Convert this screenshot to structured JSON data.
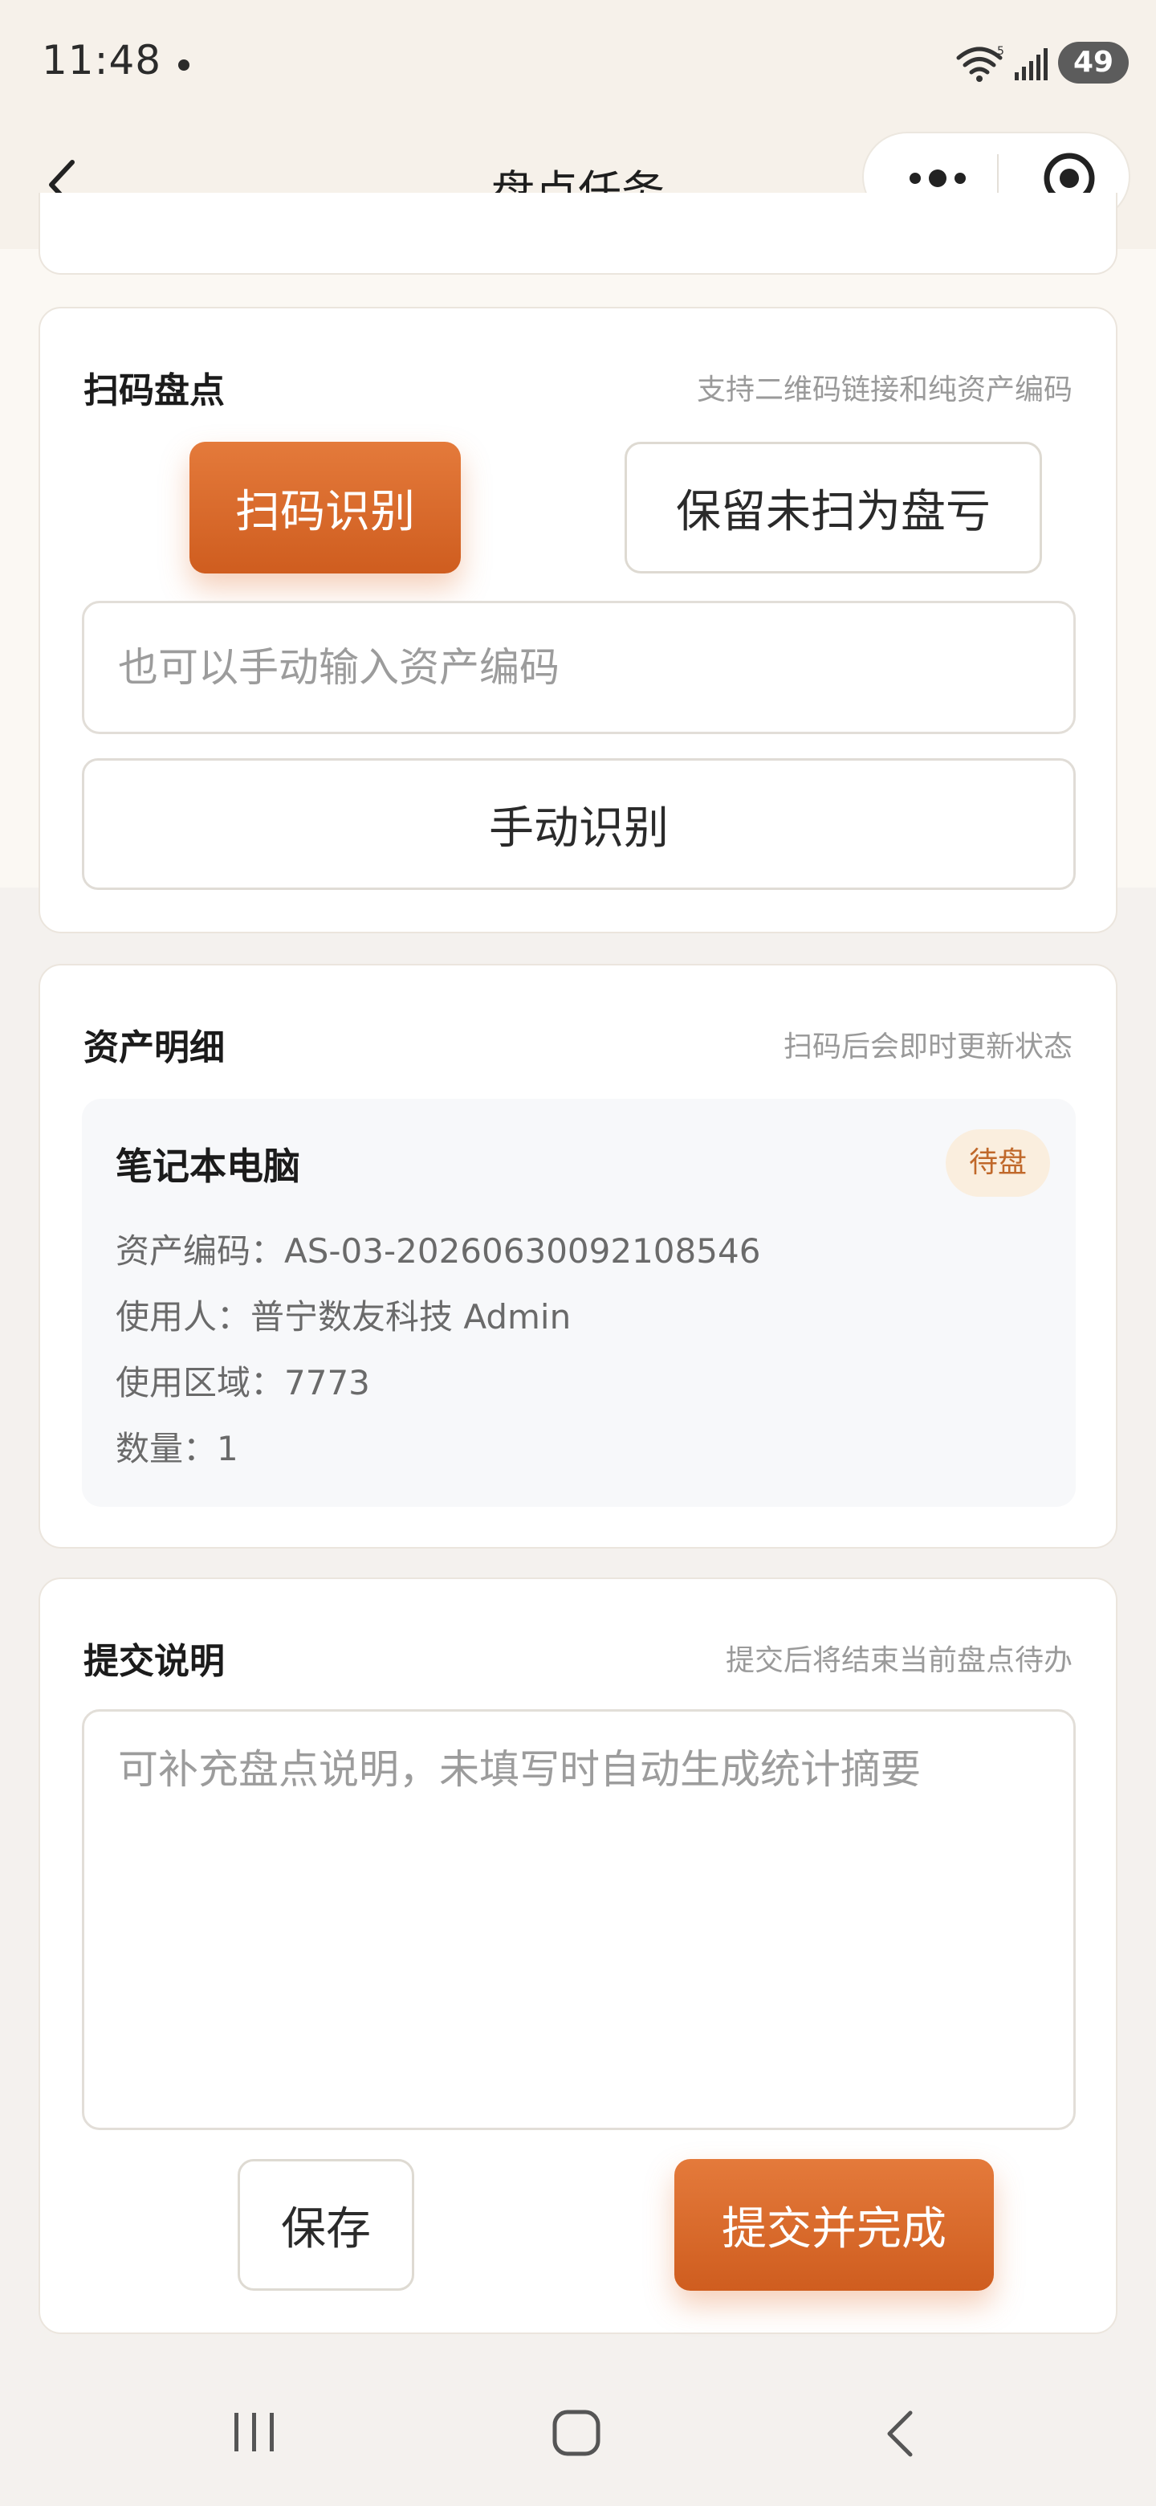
{
  "status_bar": {
    "time": "11:48",
    "battery": "49",
    "icons": [
      "wifi-icon",
      "signal-icon",
      "battery-icon"
    ]
  },
  "nav": {
    "title": "盘点任务",
    "back_icon": "chevron-left-icon",
    "more_icon": "more-dots-icon",
    "close_icon": "target-circle-icon"
  },
  "scan_section": {
    "title": "扫码盘点",
    "hint": "支持二维码链接和纯资产编码",
    "scan_button": "扫码识别",
    "mark_loss_button": "保留未扫为盘亏",
    "manual_input_placeholder": "也可以手动输入资产编码",
    "manual_button": "手动识别"
  },
  "asset_section": {
    "title": "资产明细",
    "hint": "扫码后会即时更新状态",
    "items": [
      {
        "name": "笔记本电脑",
        "status": "待盘",
        "code_line": "资产编码：AS-03-20260630092108546",
        "user_line": "使用人：普宁数友科技 Admin",
        "area_line": "使用区域：7773",
        "qty_line": "数量：1"
      }
    ]
  },
  "submit_section": {
    "title": "提交说明",
    "hint": "提交后将结束当前盘点待办",
    "note_placeholder": "可补充盘点说明，未填写时自动生成统计摘要",
    "save_button": "保存",
    "submit_button": "提交并完成"
  },
  "system_nav": {
    "icons": [
      "recent-apps-icon",
      "home-icon",
      "back-icon"
    ]
  },
  "colors": {
    "accent": "#d9692a",
    "badge_bg": "#faeede",
    "badge_text": "#c0682a",
    "page_bg": "#f6f2ec"
  }
}
